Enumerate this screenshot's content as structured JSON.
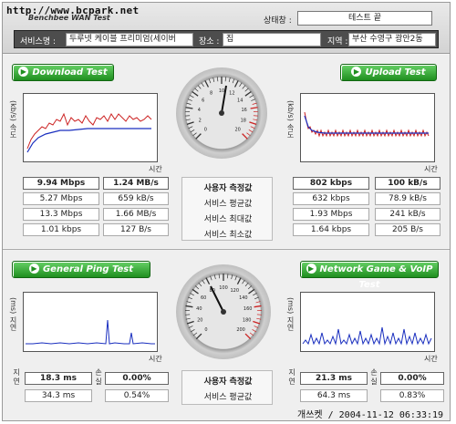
{
  "header": {
    "watermark": "http://www.bcpark.net",
    "brand": "Benchbee WAN Test",
    "status_label": "상태창 :",
    "status_value": "테스트 끝",
    "service_label": "서비스명 :",
    "service_value": "두루넷 케이블 프리미엄(세이버",
    "place_label": "장소 :",
    "place_value": "집",
    "region_label": "지역 :",
    "region_value": "부산 수영구 광안2동"
  },
  "download": {
    "button": "Download Test",
    "yaxis": "(kb/s) 속도",
    "time": "시간",
    "rows": [
      [
        "9.94 Mbps",
        "1.24 MB/s"
      ],
      [
        "5.27 Mbps",
        "659 kB/s"
      ],
      [
        "13.3 Mbps",
        "1.66 MB/s"
      ],
      [
        "1.01 kbps",
        "127 B/s"
      ]
    ]
  },
  "upload": {
    "button": "Upload Test",
    "yaxis": "(kb/s) 속도",
    "time": "시간",
    "rows": [
      [
        "802 kbps",
        "100 kB/s"
      ],
      [
        "632 kbps",
        "78.9 kB/s"
      ],
      [
        "1.93 Mbps",
        "241 kB/s"
      ],
      [
        "1.64 kbps",
        "205 B/s"
      ]
    ]
  },
  "speed_labels": [
    "사용자 측정값",
    "서비스 평균값",
    "서비스 최대값",
    "서비스 최소값"
  ],
  "gauge_top_ticks": [
    "0",
    "2",
    "4",
    "6",
    "8",
    "10",
    "12",
    "14",
    "16",
    "18",
    "20"
  ],
  "ping": {
    "button": "General Ping Test",
    "yaxis": "(ms) 지연",
    "time": "시간",
    "side_delay": "지연",
    "side_loss": "손실",
    "row_user": [
      "18.3 ms",
      "0.00%"
    ],
    "row_avg": [
      "34.3 ms",
      "0.54%"
    ]
  },
  "game": {
    "button": "Network Game & VoIP Test",
    "yaxis": "(ms) 지연",
    "time": "시간",
    "side_delay": "지연",
    "side_loss": "손실",
    "row_user": [
      "21.3 ms",
      "0.00%"
    ],
    "row_avg": [
      "64.3 ms",
      "0.83%"
    ]
  },
  "ping_labels": [
    "사용자 측정값",
    "서비스 평균값"
  ],
  "gauge_bottom_ticks": [
    "0",
    "20",
    "40",
    "60",
    "80",
    "100",
    "120",
    "140",
    "160",
    "180",
    "200"
  ],
  "footer": "개쓰켓 / 2004-11-12 06:33:19",
  "colors": {
    "button_green": "#1f8f1f",
    "graph_red": "#cc2222",
    "graph_blue": "#1a2fbf",
    "needle": "#111111"
  }
}
